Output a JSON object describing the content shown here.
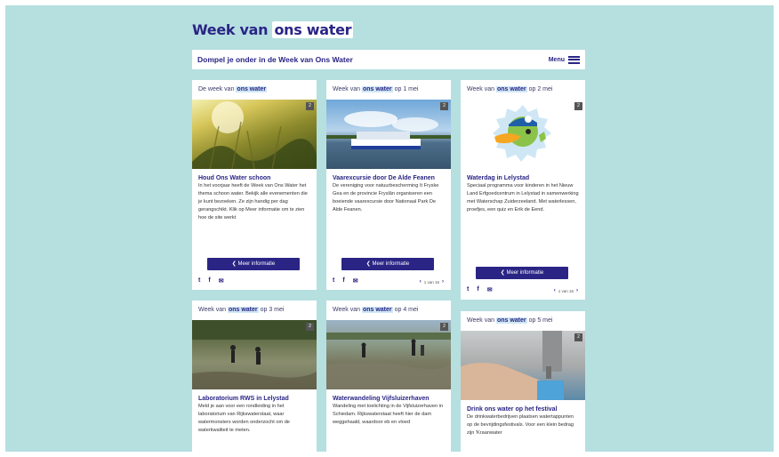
{
  "logo": {
    "text_plain": "Week van ",
    "text_highlight": "ons water"
  },
  "banner": {
    "title": "Dompel je onder in de Week van Ons Water",
    "menu_label": "Menu"
  },
  "cards": [
    {
      "head_prefix": "De week van ",
      "head_highlight": "ons water",
      "head_suffix": "",
      "title": "Houd Ons Water schoon",
      "text": "In het voorjaar heeft de Week van Ons Water het thema schoon water. Bekijk alle evenementen die je kunt bezoeken. Ze zijn handig per dag gerangschikt. Klik op Meer informatie om te zien hoe de site werkt",
      "button": "Meer informatie",
      "badge": "2",
      "pager": ""
    },
    {
      "head_prefix": "Week van ",
      "head_highlight": "ons water",
      "head_suffix": " op 1 mei",
      "title": "Vaarexcursie door De Alde Feanen",
      "text": "De vereniging voor natuurbescherming It Fryske Gea en de provincie Fryslân organiseren een boeiende vaarexcursie door Nationaal Park De Alde Feanen.",
      "button": "Meer informatie",
      "badge": "2",
      "pager": "1 van 16"
    },
    {
      "head_prefix": "Week van ",
      "head_highlight": "ons water",
      "head_suffix": " op 2 mei",
      "title": "Waterdag in Lelystad",
      "text": "Speciaal programma voor kinderen in het Nieuw Land Erfgoedcentrum in Lelystad in samenwerking met Waterschap Zuiderzeeland. Met waterlessen, proefjes, een quiz en Erik de Eend.",
      "button": "Meer informatie",
      "badge": "2",
      "pager": "1 van 16"
    },
    {
      "head_prefix": "Week van ",
      "head_highlight": "ons water",
      "head_suffix": " op 3 mei",
      "title": "Laboratorium RWS in Lelystad",
      "text": "Meld je aan voor een rondleiding in het laboratorium van Rijkswaterstaat, waar watermonsters worden onderzocht om de waterkwaliteit te meten.",
      "button": "",
      "badge": "2",
      "pager": ""
    },
    {
      "head_prefix": "Week van ",
      "head_highlight": "ons water",
      "head_suffix": " op 4 mei",
      "title": "Waterwandeling Vijfsluizerhaven",
      "text": "Wandeling met toelichting in de Vijfsluizerhaven in Schiedam. Rijkswaterstaat heeft hier de dam weggehaald, waardoor eb en vloed",
      "button": "",
      "badge": "2",
      "pager": ""
    },
    {
      "head_prefix": "Week van ",
      "head_highlight": "ons water",
      "head_suffix": " op 5 mei",
      "title": "Drink ons water op het festival",
      "text": "De drinkwaterbedrijven plaatsen watertappunten op de bevrijdingsfestivals. Voor een klein bedrag zijn 'Kraanwater",
      "button": "",
      "badge": "2",
      "pager": ""
    }
  ],
  "icons": {
    "twitter": "twitter-icon",
    "facebook": "facebook-icon",
    "mail": "mail-icon"
  },
  "colors": {
    "background": "#b6dfe0",
    "brand": "#2a2585",
    "highlight": "#cfe7f5"
  }
}
